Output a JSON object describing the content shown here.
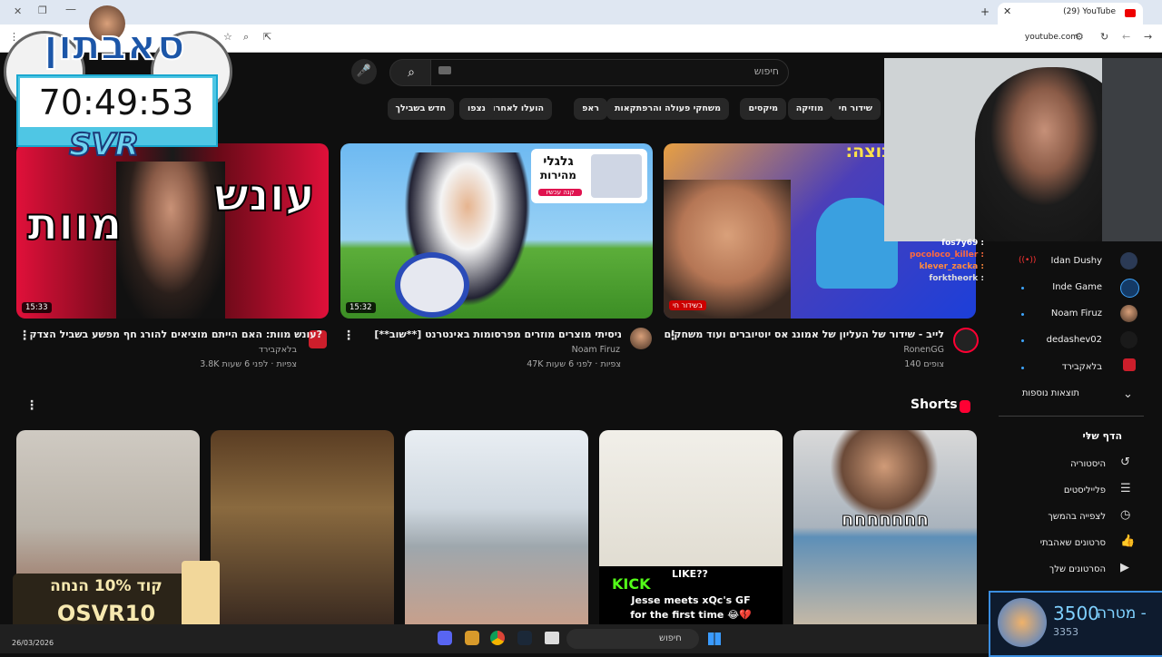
{
  "browser": {
    "tab_title": "(29) YouTube",
    "url": "youtube.com"
  },
  "search": {
    "placeholder": "חיפוש"
  },
  "chips": [
    "שידור חי",
    "מוזיקה",
    "מיקסים",
    "משחקי פעולה והרפתקאות",
    "ראפ",
    "הועלו לאחרונה",
    "נצפו",
    "חדש בשבילך"
  ],
  "videos": [
    {
      "title": "לייב - שידור של העליון של אמונג אס יוטיוברים ועוד משחקים",
      "channel": "RonenGG",
      "meta": "140 צופים",
      "live_badge": "בשידור חי",
      "thumb_text": "סטרים בקבוצה:"
    },
    {
      "title": "ניסיתי מוצרים מוזרים מפרסומות באינטרנט [**שוב**]",
      "channel": "Noam Firuz",
      "meta": "47K צפיות · לפני 6 שעות",
      "duration": "15:32",
      "thumb_text_1": "גלגלי",
      "thumb_text_2": "מהירות",
      "thumb_text_3": "קנה עכשיו"
    },
    {
      "title": "עונש מוות: האם הייתם מוציאים להורג חף מפשע בשביל הצדק?",
      "channel": "בלאקבירד",
      "meta": "3.8K צפיות · לפני 6 שעות",
      "duration": "15:33",
      "thumb_text_1": "עונש",
      "thumb_text_2": "מוות"
    }
  ],
  "shorts": {
    "title": "Shorts",
    "items": [
      {
        "caption": "חחחחחחח"
      },
      {
        "caption": "Jesse meets xQc's GF for the first time 😂💔",
        "badge": "KICK",
        "sub": "LIKE??"
      },
      {
        "caption": ""
      },
      {
        "caption": ""
      },
      {
        "caption": ""
      }
    ]
  },
  "sidebar": {
    "subscriptions": [
      {
        "name": "Idan Dushy",
        "live": true
      },
      {
        "name": "Inde Game",
        "live": false
      },
      {
        "name": "Noam Firuz",
        "live": false
      },
      {
        "name": "dedashev02",
        "live": false
      },
      {
        "name": "בלאקבירד",
        "live": false
      }
    ],
    "show_more": "תוצאות נוספות",
    "you_header": "הדף שלי",
    "you_items": [
      "היסטוריה",
      "פלייליסטים",
      "לצפייה בהמשך",
      "סרטונים שאהבתי",
      "הסרטונים שלך"
    ]
  },
  "overlay": {
    "logo": "סאבתון",
    "timer": "70:49:53",
    "tag": "SVR",
    "chat": [
      "fos7y69 :",
      "pocoloco_killer :",
      "klever_zacka :",
      "forktheork :"
    ],
    "goal_label": "מטרה -",
    "goal_value": "3500",
    "goal_current": "3353",
    "promo_line1": "קוד 10% הנחה",
    "promo_line2": "OSVR10"
  },
  "taskbar": {
    "search": "חיפוש",
    "date": "26/03/2026"
  },
  "colors": {
    "bg": "#0f0f0f",
    "chip": "#272727",
    "accent": "#ff0033",
    "link": "#3ea6ff"
  }
}
